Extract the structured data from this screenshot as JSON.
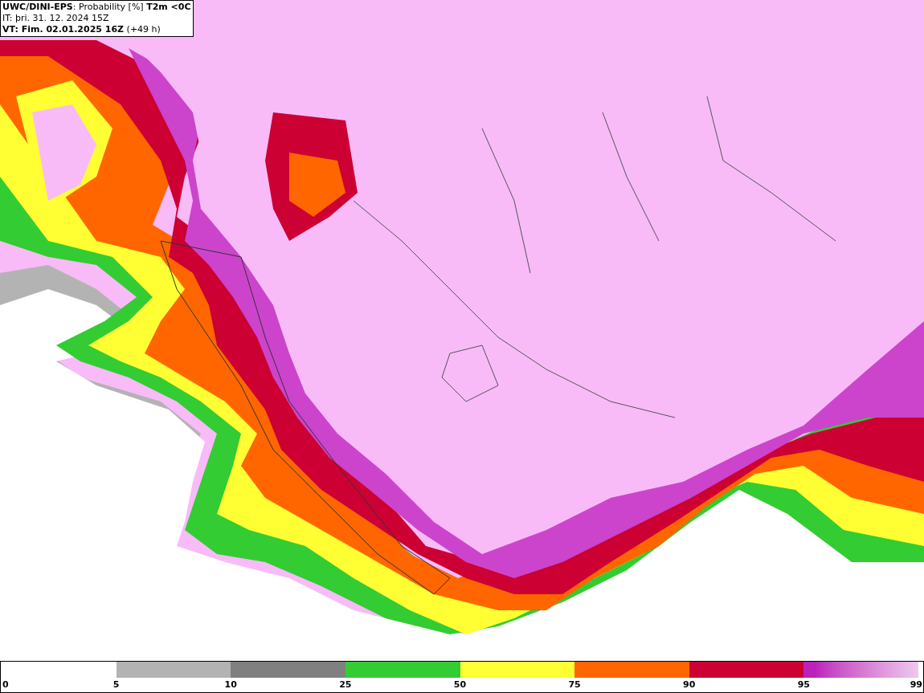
{
  "title_box": {
    "lines": [
      "**UWC/DINI-EPS**: Probability [%] **T2m <0C**",
      "IT: þri. 31. 12. 2024 15Z",
      "**VT: Fim. 02.01.2025 16Z** (+49 h)"
    ]
  },
  "legend": {
    "segments": [
      {
        "kind": "solid",
        "color": "#b3b3b3"
      },
      {
        "kind": "solid",
        "color": "#808080"
      },
      {
        "kind": "solid",
        "color": "#33cc33"
      },
      {
        "kind": "solid",
        "color": "#ffff33"
      },
      {
        "kind": "solid",
        "color": "#ff6600"
      },
      {
        "kind": "solid",
        "color": "#cc0033"
      },
      {
        "kind": "gradient",
        "color": "#bb22bb"
      }
    ],
    "ticks": [
      "0",
      "5",
      "10",
      "25",
      "50",
      "75",
      "90",
      "95",
      "99"
    ]
  }
}
